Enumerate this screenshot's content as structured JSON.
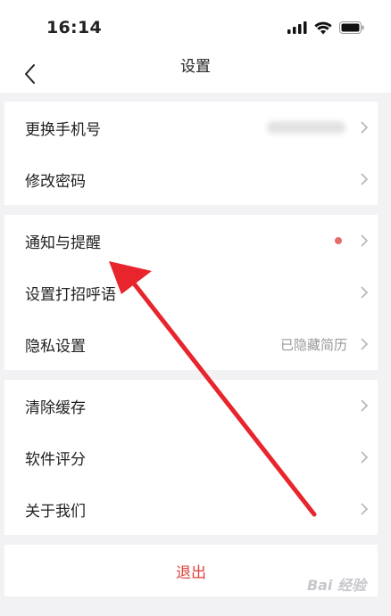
{
  "status_bar": {
    "time": "16:14"
  },
  "nav": {
    "title": "设置"
  },
  "groups": [
    [
      {
        "label": "更换手机号",
        "value": ""
      },
      {
        "label": "修改密码",
        "value": ""
      }
    ],
    [
      {
        "label": "通知与提醒",
        "value": ""
      },
      {
        "label": "设置打招呼语",
        "value": ""
      },
      {
        "label": "隐私设置",
        "value": "已隐藏简历"
      }
    ],
    [
      {
        "label": "清除缓存",
        "value": ""
      },
      {
        "label": "软件评分",
        "value": ""
      },
      {
        "label": "关于我们",
        "value": ""
      }
    ]
  ],
  "logout": {
    "label": "退出"
  },
  "colors": {
    "accent_red": "#e0403a",
    "notification_dot": "#e56b68",
    "annotation_arrow": "#e8252c"
  },
  "watermark": {
    "text": "Bai 经验"
  }
}
